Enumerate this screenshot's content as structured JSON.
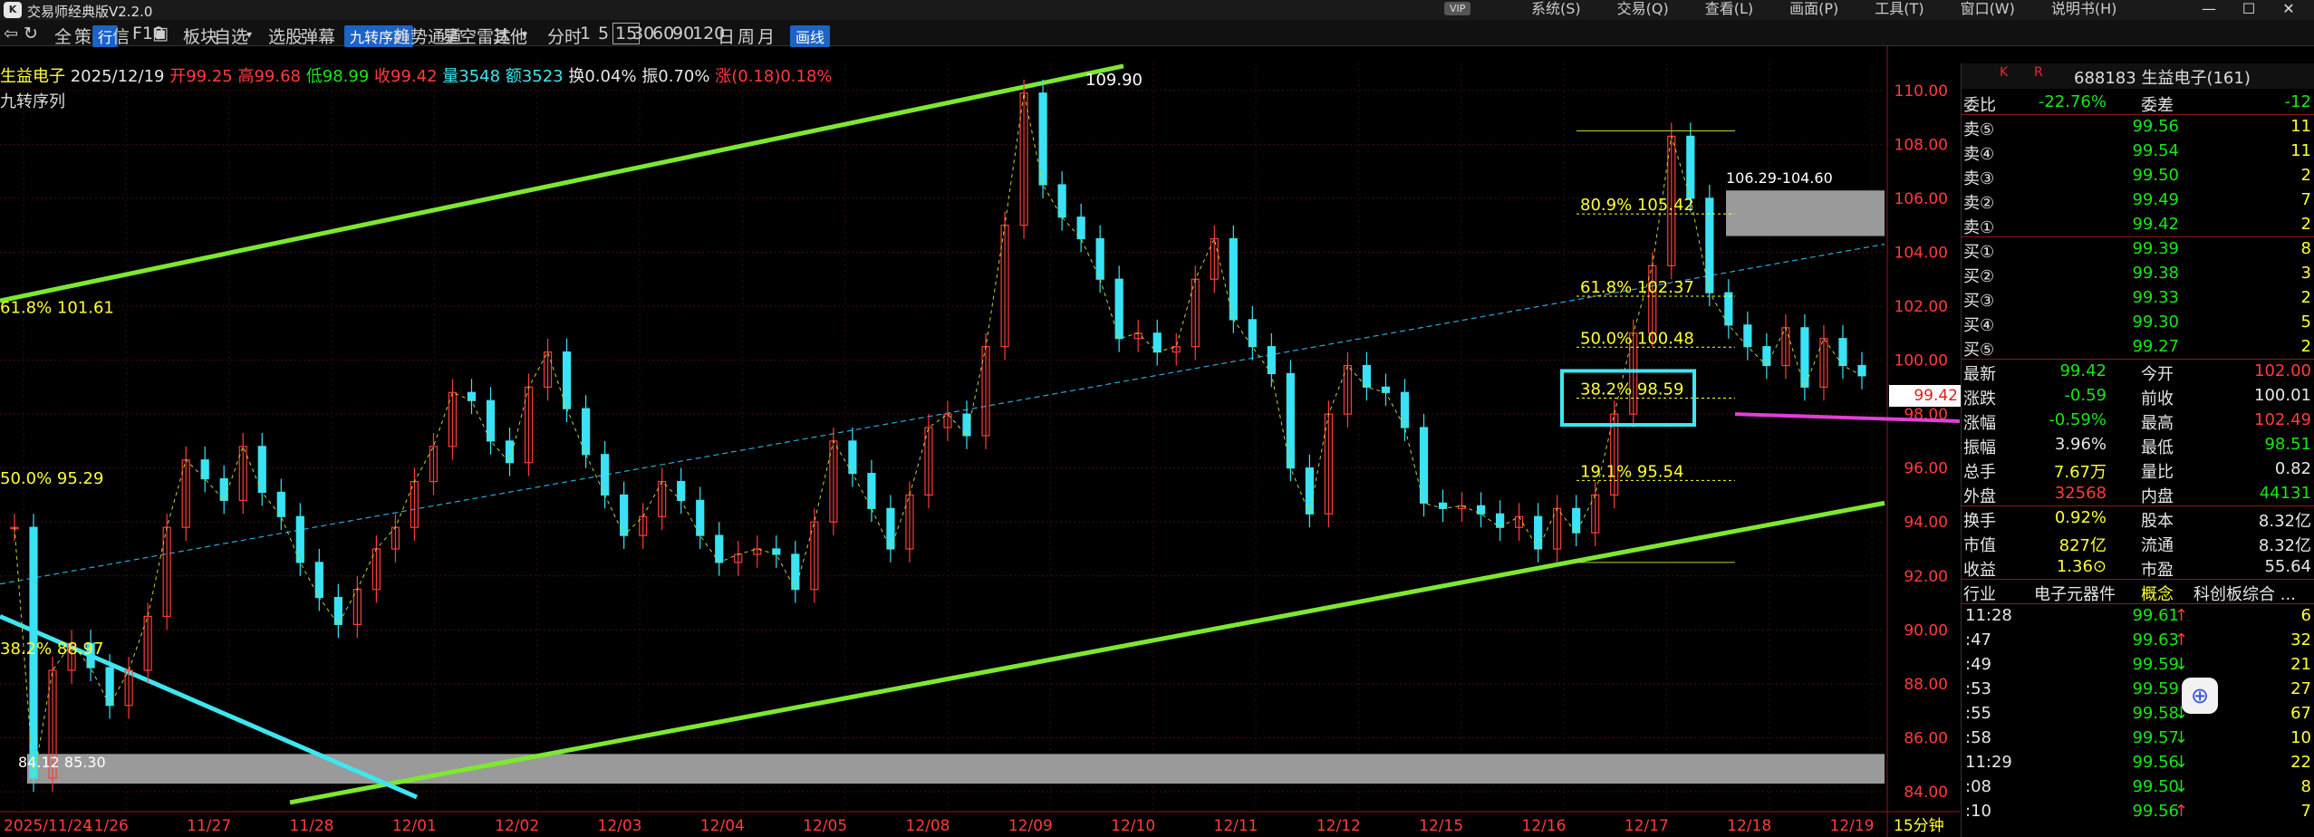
{
  "app": {
    "title": "交易师经典版V2.2.0",
    "vip": "VIP",
    "menus": [
      "系统(S)",
      "交易(Q)",
      "查看(L)",
      "画面(P)",
      "工具(T)",
      "窗口(W)",
      "说明书(H)"
    ]
  },
  "toolbar": {
    "items": [
      "全",
      "策",
      "行",
      "信",
      "F10",
      "板块",
      "自选",
      "选股",
      "弹幕",
      "九转序列",
      "趋势通道",
      "星空雷达",
      "其他",
      "分时",
      "1",
      "5",
      "15",
      "30",
      "60",
      "90",
      "120",
      "日",
      "周",
      "月",
      "画线"
    ],
    "active_period": "15"
  },
  "stock": {
    "name": "生益电子",
    "date": "2025/12/19",
    "open": "开99.25",
    "high": "高99.68",
    "low": "低98.99",
    "close": "收99.42",
    "volume": "量3548",
    "amount": "额3523",
    "turnover": "换0.04%",
    "amplitude": "振0.70%",
    "change": "涨(0.18)0.18%",
    "indicator": "九转序列"
  },
  "chart_data": {
    "type": "candlestick",
    "period": "15分钟",
    "ylim": [
      84,
      111
    ],
    "y_ticks": [
      84,
      86,
      88,
      90,
      92,
      94,
      96,
      98,
      100,
      102,
      104,
      106,
      108,
      110
    ],
    "y_tick_labels": [
      "84.00",
      "86.00",
      "88.00",
      "90.00",
      "92.00",
      "94.00",
      "96.00",
      "98.00",
      "100.00",
      "102.00",
      "104.00",
      "106.00",
      "108.00",
      "110.00"
    ],
    "x_labels": [
      "2025/11/24",
      "11/26",
      "11/27",
      "11/28",
      "12/01",
      "12/02",
      "12/03",
      "12/04",
      "12/05",
      "12/08",
      "12/09",
      "12/10",
      "12/11",
      "12/12",
      "12/15",
      "12/16",
      "12/17",
      "12/18",
      "12/19"
    ],
    "last_price": "99.42",
    "period_label": "15分钟",
    "close_path": [
      93.8,
      84.5,
      88.5,
      89.5,
      88.6,
      87.2,
      88.5,
      90.5,
      93.8,
      96.3,
      95.6,
      94.8,
      96.8,
      95.1,
      94.2,
      92.5,
      91.2,
      90.2,
      91.5,
      93.0,
      93.8,
      95.5,
      96.8,
      98.8,
      98.5,
      97.0,
      96.2,
      99.0,
      100.3,
      98.2,
      96.5,
      95.0,
      93.5,
      94.2,
      95.5,
      94.8,
      93.5,
      92.5,
      92.8,
      93.0,
      92.8,
      91.5,
      94.0,
      97.0,
      95.8,
      94.5,
      93.0,
      95.0,
      97.5,
      98.0,
      97.2,
      100.5,
      105.0,
      109.9,
      106.5,
      105.3,
      104.5,
      103.0,
      100.8,
      101.0,
      100.3,
      100.5,
      103.0,
      104.5,
      101.5,
      100.5,
      99.5,
      96.0,
      94.3,
      98.0,
      99.8,
      99.0,
      98.8,
      97.5,
      94.7,
      94.5,
      94.6,
      94.3,
      93.8,
      94.2,
      93.0,
      94.5,
      93.6,
      95.0,
      98.0,
      101.0,
      103.5,
      108.3,
      106.0,
      102.5,
      101.3,
      100.5,
      99.8,
      101.2,
      99.0,
      100.8,
      99.8,
      99.42
    ],
    "annotations": {
      "high_label": "109.90",
      "low_label": "84.12 85.30",
      "zone_label": "106.29-104.60",
      "fib_left": [
        {
          "text": "61.8% 101.61",
          "y": 101.61
        },
        {
          "text": "50.0% 95.29",
          "y": 95.29
        },
        {
          "text": "38.2% 88.97",
          "y": 88.97
        }
      ],
      "fib_right": [
        {
          "text": "80.9% 105.42",
          "y": 105.42
        },
        {
          "text": "61.8% 102.37",
          "y": 102.37
        },
        {
          "text": "50.0% 100.48",
          "y": 100.48
        },
        {
          "text": "38.2% 98.59",
          "y": 98.59
        },
        {
          "text": "19.1% 95.54",
          "y": 95.54
        }
      ]
    },
    "grid": true
  },
  "quote_panel": {
    "code": "688183",
    "name": "生益电子(161)",
    "k_label": "K",
    "r_label": "R",
    "weibi_label": "委比",
    "weibi": "-22.76%",
    "weicha_label": "委差",
    "weicha": "-12",
    "sells": [
      {
        "label": "卖⑤",
        "price": "99.56",
        "vol": "11"
      },
      {
        "label": "卖④",
        "price": "99.54",
        "vol": "11"
      },
      {
        "label": "卖③",
        "price": "99.50",
        "vol": "2"
      },
      {
        "label": "卖②",
        "price": "99.49",
        "vol": "7"
      },
      {
        "label": "卖①",
        "price": "99.42",
        "vol": "2"
      }
    ],
    "buys": [
      {
        "label": "买①",
        "price": "99.39",
        "vol": "8"
      },
      {
        "label": "买②",
        "price": "99.38",
        "vol": "3"
      },
      {
        "label": "买③",
        "price": "99.33",
        "vol": "2"
      },
      {
        "label": "买④",
        "price": "99.30",
        "vol": "5"
      },
      {
        "label": "买⑤",
        "price": "99.27",
        "vol": "2"
      }
    ],
    "stats": [
      {
        "l1": "最新",
        "v1": "99.42",
        "c1": "green",
        "l2": "今开",
        "v2": "102.00",
        "c2": "red"
      },
      {
        "l1": "涨跌",
        "v1": "-0.59",
        "c1": "green",
        "l2": "前收",
        "v2": "100.01",
        "c2": "white"
      },
      {
        "l1": "涨幅",
        "v1": "-0.59%",
        "c1": "green",
        "l2": "最高",
        "v2": "102.49",
        "c2": "red"
      },
      {
        "l1": "振幅",
        "v1": "3.96%",
        "c1": "white",
        "l2": "最低",
        "v2": "98.51",
        "c2": "green"
      },
      {
        "l1": "总手",
        "v1": "7.67万",
        "c1": "yellow",
        "l2": "量比",
        "v2": "0.82",
        "c2": "white"
      },
      {
        "l1": "外盘",
        "v1": "32568",
        "c1": "red",
        "l2": "内盘",
        "v2": "44131",
        "c2": "green"
      }
    ],
    "stats2": [
      {
        "l1": "换手",
        "v1": "0.92%",
        "l2": "股本",
        "v2": "8.32亿"
      },
      {
        "l1": "市值",
        "v1": "827亿",
        "l2": "流通",
        "v2": "8.32亿"
      },
      {
        "l1": "收益",
        "v1": "1.36⊙",
        "l2": "市盈",
        "v2": "55.64"
      }
    ],
    "industry_label": "行业",
    "industry": "电子元器件",
    "concept_label": "概念",
    "concept": "科创板综合 ...",
    "ticks": [
      {
        "time": "11:28",
        "price": "99.61",
        "arrow": "↑",
        "vol": "6"
      },
      {
        "time": ":47",
        "price": "99.63",
        "arrow": "↑",
        "vol": "32"
      },
      {
        "time": ":49",
        "price": "99.59",
        "arrow": "↓",
        "vol": "21"
      },
      {
        "time": ":53",
        "price": "99.59",
        "arrow": "",
        "vol": "27"
      },
      {
        "time": ":55",
        "price": "99.58",
        "arrow": "↓",
        "vol": "67"
      },
      {
        "time": ":58",
        "price": "99.57",
        "arrow": "↓",
        "vol": "10"
      },
      {
        "time": "11:29",
        "price": "99.56",
        "arrow": "↓",
        "vol": "22"
      },
      {
        "time": ":08",
        "price": "99.50",
        "arrow": "↓",
        "vol": "8"
      },
      {
        "time": ":10",
        "price": "99.56",
        "arrow": "↑",
        "vol": "7"
      }
    ]
  }
}
